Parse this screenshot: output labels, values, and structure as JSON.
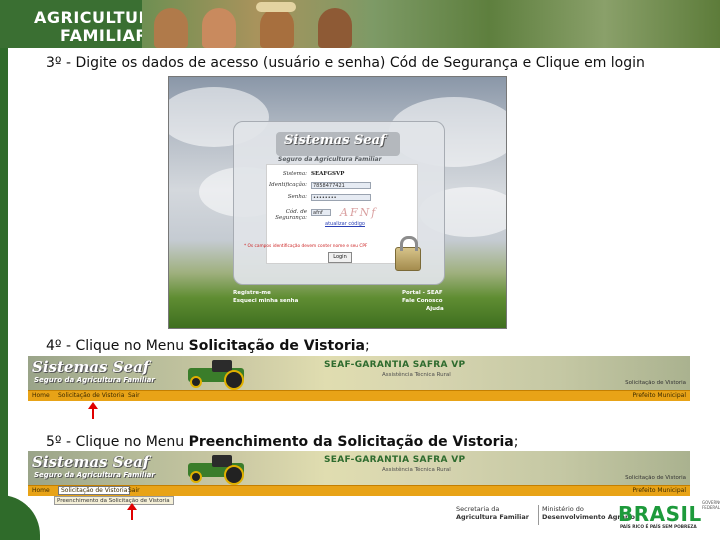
{
  "header": {
    "logo_line1": "AGRICULTURA",
    "logo_line2": "FAMILIAR"
  },
  "steps": {
    "step3": "3º - Digite os dados de acesso (usuário e senha) Cód de Segurança e Clique em login",
    "step4_prefix": "4º - Clique no Menu ",
    "step4_bold": "Solicitação de Vistoria",
    "step4_suffix": ";",
    "step5_prefix": "5º - Clique no Menu ",
    "step5_bold": "Preenchimento da Solicitação de Vistoria",
    "step5_suffix": ";"
  },
  "login_screen": {
    "logo_title": "Sistemas Seaf",
    "logo_subtitle": "Seguro da Agricultura Familiar",
    "sistema_label": "Sistema:",
    "sistema_value": "SEAFGSVP",
    "identificacao_label": "Identificação:",
    "identificacao_value": "7858477421",
    "senha_label": "Senha:",
    "senha_value": "••••••••",
    "cod_label": "Cód. de Segurança:",
    "cod_value": "afnf",
    "captcha_text": "AFNf",
    "new_code_link": "atualizar código",
    "warning": "* Os campos identificação devem conter nome e seu CPF",
    "login_button": "Login",
    "register_link": "Registre-me",
    "forgot_link": "Esqueci minha senha",
    "portal_link": "Portal - SEAF",
    "contact_link": "Fale Conosco",
    "help_link": "Ajuda"
  },
  "banner1": {
    "logo_title": "Sistemas Seaf",
    "logo_subtitle": "Seguro da Agricultura Familiar",
    "system_title": "SEAF-GARANTIA SAFRA VP",
    "system_sub": "Assistência Técnica Rural",
    "top_right": "Solicitação de Vistoria",
    "menu": [
      "Home",
      "Solicitação de Vistoria",
      "Sair"
    ],
    "menu_right": "Prefeito Municipal"
  },
  "banner2": {
    "logo_title": "Sistemas Seaf",
    "logo_subtitle": "Seguro da Agricultura Familiar",
    "system_title": "SEAF-GARANTIA SAFRA VP",
    "system_sub": "Assistência Técnica Rural",
    "top_right": "Solicitação de Vistoria",
    "menu": [
      "Home",
      "Solicitação de Vistoria",
      "Sair"
    ],
    "menu_right": "Prefeito Municipal",
    "dropdown_item": "Preenchimento da Solicitação de Vistoria"
  },
  "footer": {
    "secretaria_line1": "Secretaria da",
    "secretaria_line2": "Agricultura Familiar",
    "ministerio_line1": "Ministério do",
    "ministerio_line2": "Desenvolvimento Agrário",
    "brasil_word": "BRASIL",
    "brasil_tag": "PAÍS RICO É PAÍS SEM POBREZA",
    "gov_label": "GOVERNO FEDERAL"
  },
  "colors": {
    "header_green": "#3a6f32",
    "menu_orange": "#e8a317",
    "arrow_red": "#e00000",
    "title_green": "#2e6b2e"
  }
}
